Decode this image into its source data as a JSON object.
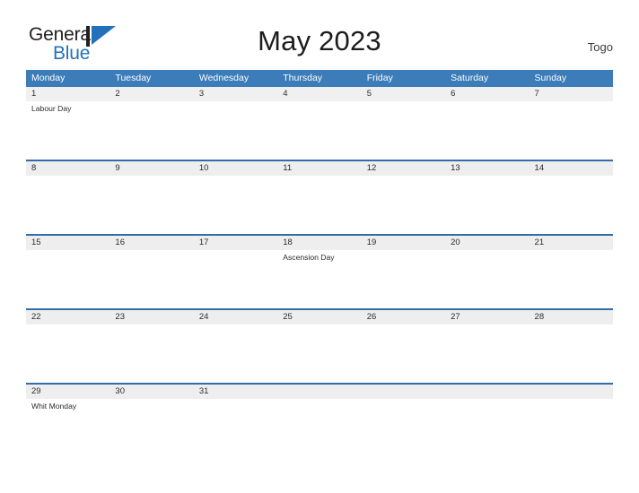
{
  "brand": {
    "name_line1": "General",
    "name_line2": "Blue",
    "mark_icon": "blue-triangle-logo-icon",
    "color_dark": "#231f20",
    "color_blue": "#2372b9"
  },
  "header": {
    "title": "May 2023",
    "country": "Togo",
    "accent_color": "#3b7cb9",
    "row_border_color": "#2f6ea8",
    "daynum_band_color": "#eeeeee"
  },
  "weekdays": [
    "Monday",
    "Tuesday",
    "Wednesday",
    "Thursday",
    "Friday",
    "Saturday",
    "Sunday"
  ],
  "weeks": [
    {
      "days": [
        {
          "num": "1",
          "events": [
            "Labour Day"
          ]
        },
        {
          "num": "2",
          "events": []
        },
        {
          "num": "3",
          "events": []
        },
        {
          "num": "4",
          "events": []
        },
        {
          "num": "5",
          "events": []
        },
        {
          "num": "6",
          "events": []
        },
        {
          "num": "7",
          "events": []
        }
      ]
    },
    {
      "days": [
        {
          "num": "8",
          "events": []
        },
        {
          "num": "9",
          "events": []
        },
        {
          "num": "10",
          "events": []
        },
        {
          "num": "11",
          "events": []
        },
        {
          "num": "12",
          "events": []
        },
        {
          "num": "13",
          "events": []
        },
        {
          "num": "14",
          "events": []
        }
      ]
    },
    {
      "days": [
        {
          "num": "15",
          "events": []
        },
        {
          "num": "16",
          "events": []
        },
        {
          "num": "17",
          "events": []
        },
        {
          "num": "18",
          "events": [
            "Ascension Day"
          ]
        },
        {
          "num": "19",
          "events": []
        },
        {
          "num": "20",
          "events": []
        },
        {
          "num": "21",
          "events": []
        }
      ]
    },
    {
      "days": [
        {
          "num": "22",
          "events": []
        },
        {
          "num": "23",
          "events": []
        },
        {
          "num": "24",
          "events": []
        },
        {
          "num": "25",
          "events": []
        },
        {
          "num": "26",
          "events": []
        },
        {
          "num": "27",
          "events": []
        },
        {
          "num": "28",
          "events": []
        }
      ]
    },
    {
      "days": [
        {
          "num": "29",
          "events": [
            "Whit Monday"
          ]
        },
        {
          "num": "30",
          "events": []
        },
        {
          "num": "31",
          "events": []
        },
        {
          "num": "",
          "events": []
        },
        {
          "num": "",
          "events": []
        },
        {
          "num": "",
          "events": []
        },
        {
          "num": "",
          "events": []
        }
      ]
    }
  ]
}
